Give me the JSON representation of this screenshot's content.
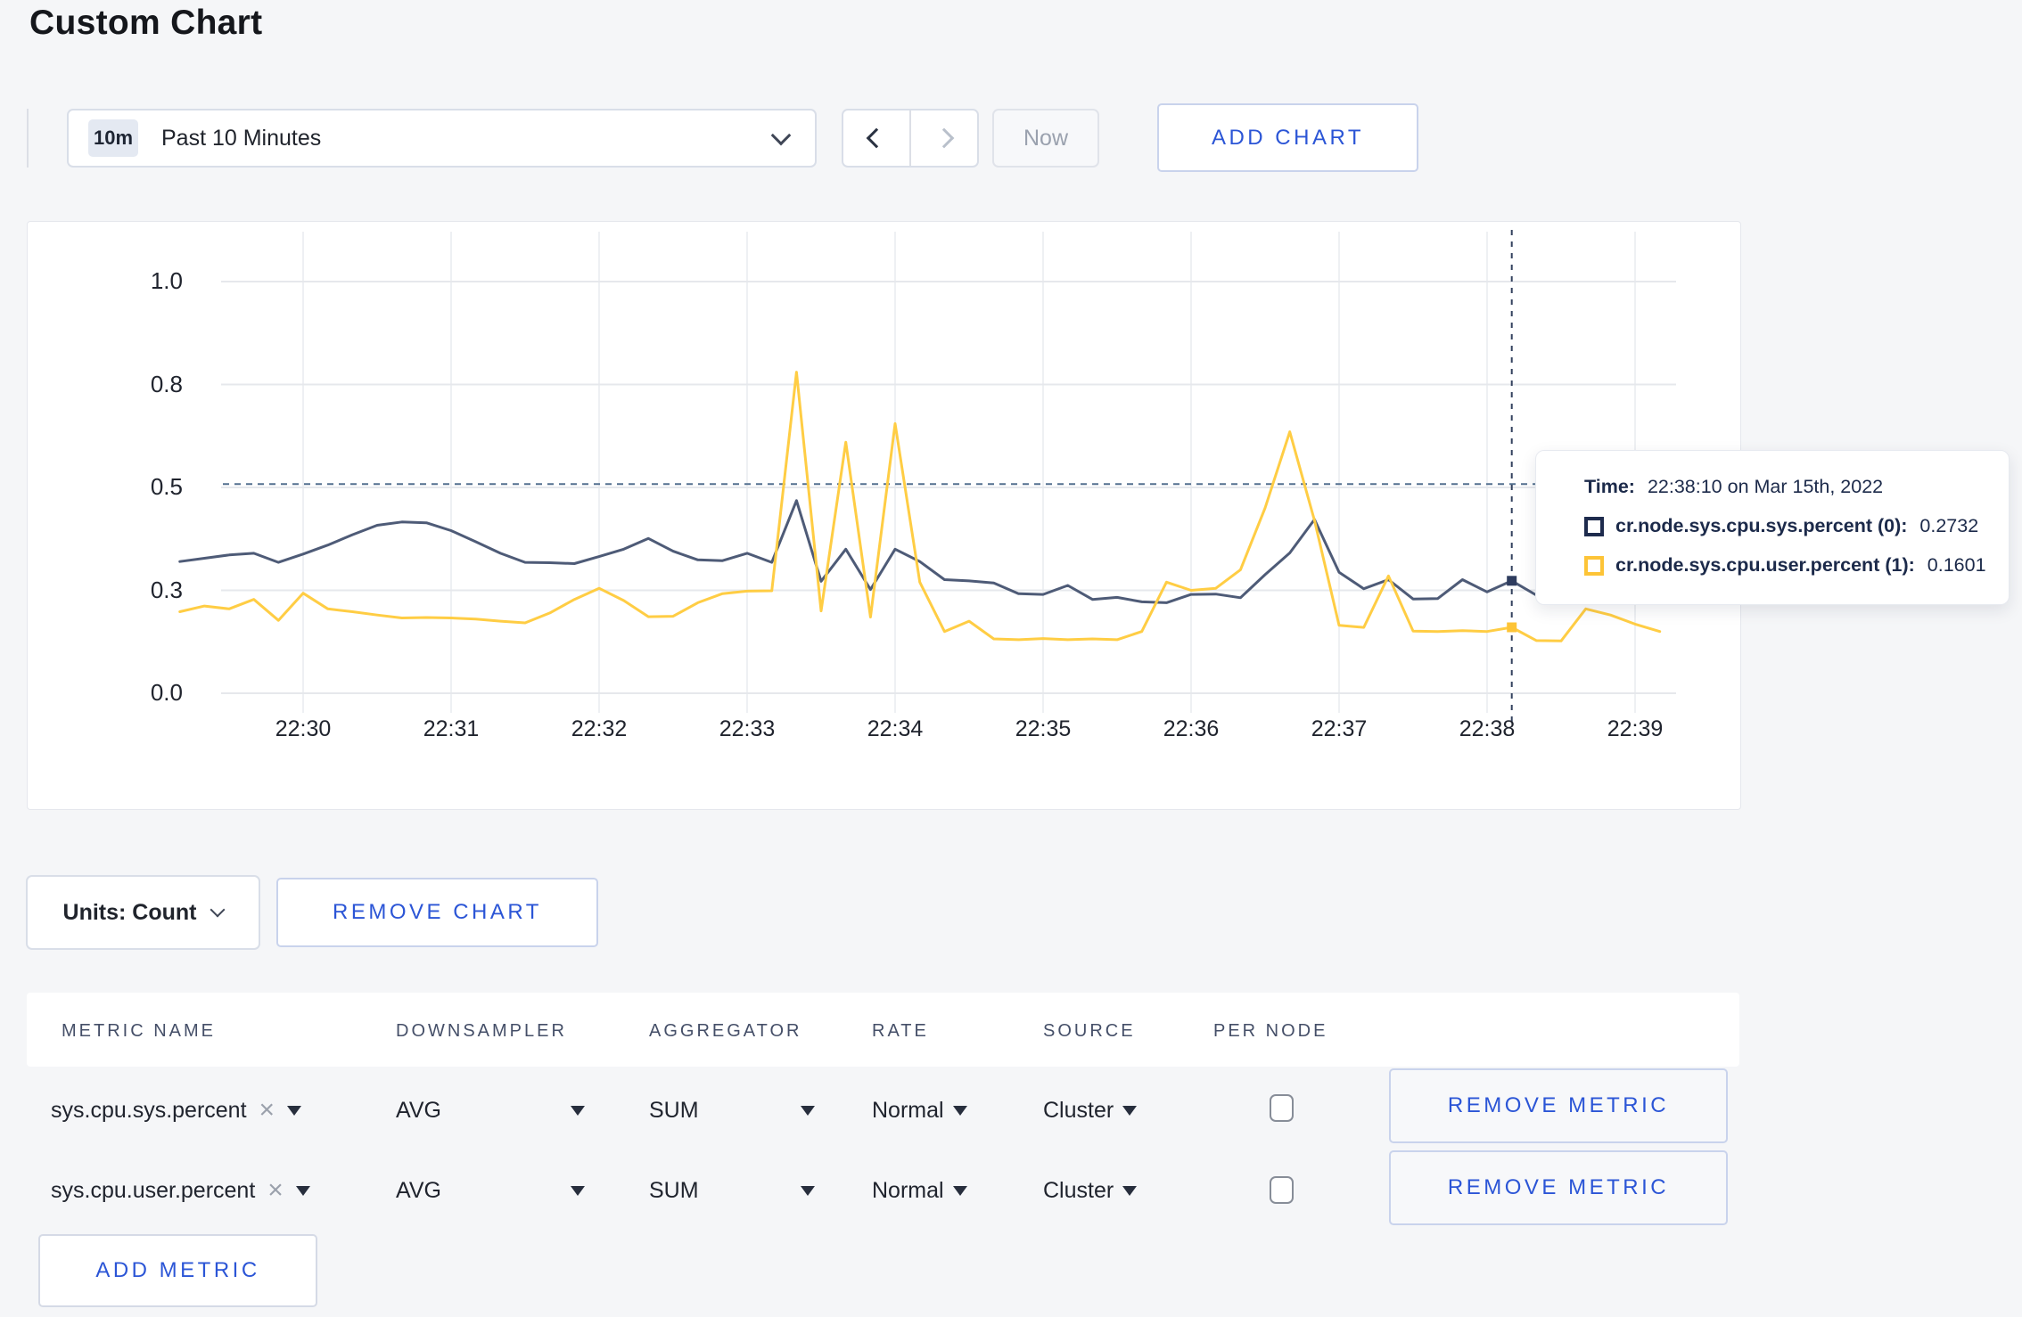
{
  "page": {
    "title": "Custom Chart"
  },
  "toolbar": {
    "range_badge": "10m",
    "range_label": "Past 10 Minutes",
    "now_label": "Now",
    "add_chart_label": "ADD CHART"
  },
  "chart_data": {
    "type": "line",
    "title": "",
    "xlabel": "",
    "ylabel": "",
    "ylim": [
      0,
      1
    ],
    "grid": true,
    "legend_position": "tooltip-overlay",
    "x_ticks": [
      "22:30",
      "22:31",
      "22:32",
      "22:33",
      "22:34",
      "22:35",
      "22:36",
      "22:37",
      "22:38",
      "22:39"
    ],
    "y_ticks": [
      "1.0",
      "0.8",
      "0.5",
      "0.3",
      "0.0"
    ],
    "y_tick_values": [
      1.0,
      0.75,
      0.5,
      0.25,
      0.0
    ],
    "x_start_offset_min": -0.8333,
    "x_step_min": 0.16667,
    "series": [
      {
        "name": "cr.node.sys.cpu.sys.percent (0)",
        "color": "#4e5b77",
        "dot_color": "#2e3c5e",
        "values": [
          0.32,
          0.328,
          0.336,
          0.34,
          0.318,
          0.338,
          0.36,
          0.385,
          0.408,
          0.416,
          0.414,
          0.395,
          0.368,
          0.34,
          0.318,
          0.317,
          0.315,
          0.332,
          0.35,
          0.376,
          0.345,
          0.324,
          0.322,
          0.34,
          0.318,
          0.468,
          0.272,
          0.35,
          0.252,
          0.35,
          0.32,
          0.276,
          0.273,
          0.268,
          0.242,
          0.24,
          0.262,
          0.228,
          0.233,
          0.222,
          0.22,
          0.24,
          0.241,
          0.232,
          0.288,
          0.341,
          0.422,
          0.294,
          0.254,
          0.276,
          0.229,
          0.23,
          0.276,
          0.246,
          0.2732,
          0.238,
          0.245,
          0.252,
          0.262,
          0.3,
          0.33
        ]
      },
      {
        "name": "cr.node.sys.cpu.user.percent (1)",
        "color": "#ffcd44",
        "dot_color": "#fdc437",
        "values": [
          0.198,
          0.212,
          0.205,
          0.228,
          0.177,
          0.243,
          0.205,
          0.198,
          0.19,
          0.183,
          0.184,
          0.183,
          0.18,
          0.175,
          0.171,
          0.195,
          0.228,
          0.255,
          0.225,
          0.186,
          0.187,
          0.22,
          0.242,
          0.248,
          0.249,
          0.78,
          0.2,
          0.61,
          0.185,
          0.655,
          0.27,
          0.15,
          0.175,
          0.132,
          0.13,
          0.133,
          0.13,
          0.132,
          0.13,
          0.15,
          0.27,
          0.25,
          0.255,
          0.3,
          0.45,
          0.635,
          0.42,
          0.165,
          0.16,
          0.285,
          0.151,
          0.15,
          0.152,
          0.15,
          0.1601,
          0.128,
          0.127,
          0.205,
          0.19,
          0.168,
          0.15
        ]
      }
    ],
    "crosshair": {
      "x_index": 54,
      "hline_value": 0.508
    }
  },
  "tooltip": {
    "time_label": "Time:",
    "time_value": "22:38:10 on Mar 15th, 2022",
    "series": [
      {
        "label": "cr.node.sys.cpu.sys.percent (0):",
        "value": "0.2732",
        "color": "#1e2b4d"
      },
      {
        "label": "cr.node.sys.cpu.user.percent (1):",
        "value": "0.1601",
        "color": "#fdc437"
      }
    ]
  },
  "chart_controls": {
    "units_label": "Units: Count",
    "remove_chart_label": "REMOVE CHART"
  },
  "metrics_table": {
    "headers": [
      "METRIC NAME",
      "DOWNSAMPLER",
      "AGGREGATOR",
      "RATE",
      "SOURCE",
      "PER NODE"
    ],
    "rows": [
      {
        "metric": "sys.cpu.sys.percent",
        "downsampler": "AVG",
        "aggregator": "SUM",
        "rate": "Normal",
        "source": "Cluster",
        "per_node_checked": false,
        "remove_label": "REMOVE METRIC"
      },
      {
        "metric": "sys.cpu.user.percent",
        "downsampler": "AVG",
        "aggregator": "SUM",
        "rate": "Normal",
        "source": "Cluster",
        "per_node_checked": false,
        "remove_label": "REMOVE METRIC"
      }
    ],
    "add_metric_label": "ADD METRIC"
  }
}
